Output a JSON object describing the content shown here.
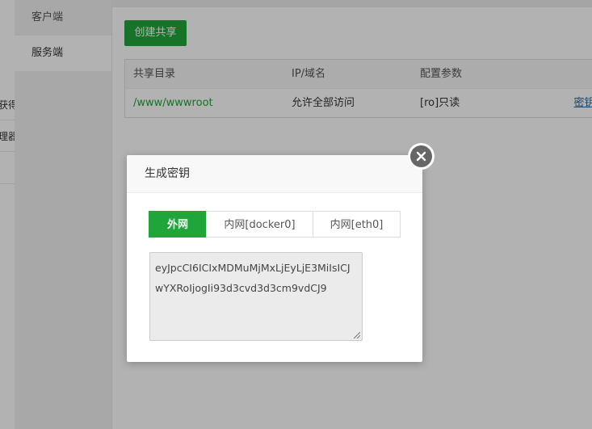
{
  "sidebar": {
    "fragments": [
      "获得",
      "理器"
    ],
    "tabs": [
      {
        "label": "客户端",
        "active": false
      },
      {
        "label": "服务端",
        "active": true
      }
    ]
  },
  "toolbar": {
    "create_label": "创建共享"
  },
  "table": {
    "headers": [
      "共享目录",
      "IP/域名",
      "配置参数",
      ""
    ],
    "rows": [
      {
        "path": "/www/wwwroot",
        "ip": "允许全部访问",
        "params": "[ro]只读",
        "op_key": "密钥",
        "op_sep": "|"
      }
    ]
  },
  "modal": {
    "title": "生成密钥",
    "tabs": [
      {
        "label": "外网",
        "active": true
      },
      {
        "label": "内网[docker0]",
        "active": false
      },
      {
        "label": "内网[eth0]",
        "active": false
      }
    ],
    "key_value": "eyJpcCI6ICIxMDMuMjMxLjEyLjE3MiIsICJwYXRoIjogIi93d3cvd3d3cm9vdCJ9"
  },
  "colors": {
    "accent": "#20a53a",
    "link": "#2a6496"
  },
  "icons": {
    "close": "close-icon",
    "resize": "resize-handle-icon"
  }
}
